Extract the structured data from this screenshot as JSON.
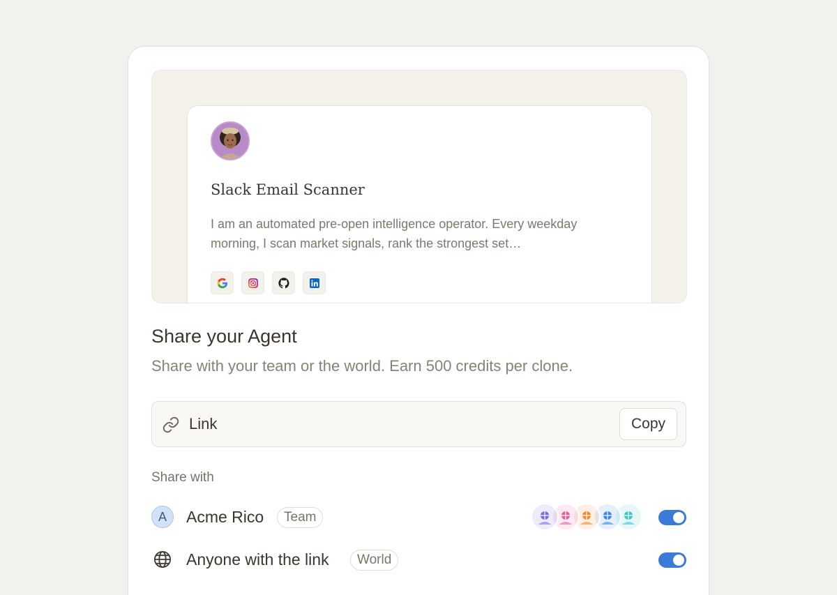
{
  "agent": {
    "name": "Slack Email Scanner",
    "description": "I am an automated pre-open intelligence operator. Every weekday morning, I scan market signals, rank the strongest set…",
    "integrations": [
      {
        "icon": "google-icon"
      },
      {
        "icon": "instagram-icon"
      },
      {
        "icon": "github-icon"
      },
      {
        "icon": "linkedin-icon"
      }
    ]
  },
  "share": {
    "title": "Share your Agent",
    "subtitle": "Share with your team or the world. Earn 500 credits per clone.",
    "link_label": "Link",
    "copy_label": "Copy",
    "share_with_label": "Share with"
  },
  "options": {
    "team": {
      "avatar_letter": "A",
      "label": "Acme Rico",
      "tag": "Team",
      "enabled": true
    },
    "world": {
      "label": "Anyone with the link",
      "tag": "World",
      "enabled": true
    }
  },
  "colors": {
    "accent": "#3b7ad6",
    "members": [
      "#7c6be0",
      "#e0609e",
      "#f08a2c",
      "#3d86e8",
      "#3fc3c6"
    ]
  }
}
